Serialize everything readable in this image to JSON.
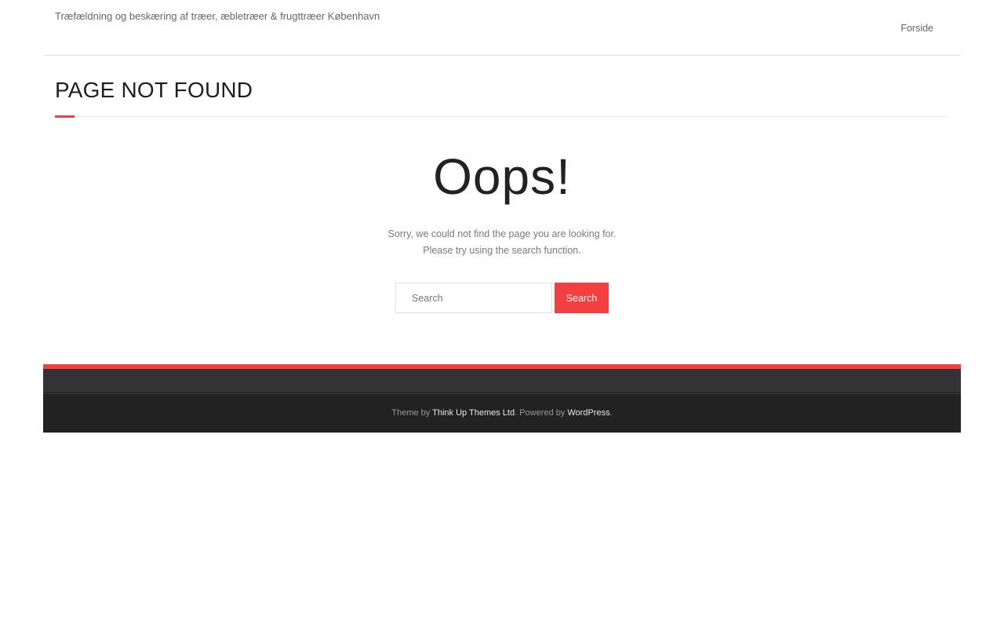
{
  "header": {
    "tagline": "Træfældning og beskæring af træer, æbletræer & frugttræer København",
    "nav": {
      "home_label": "Forside"
    }
  },
  "intro": {
    "title": "PAGE NOT FOUND"
  },
  "content": {
    "heading": "Oops!",
    "message_line1": "Sorry, we could not find the page you are looking for.",
    "message_line2": "Please try using the search function.",
    "search": {
      "placeholder": "Search",
      "button_label": "Search"
    }
  },
  "footer": {
    "theme_prefix": "Theme by",
    "theme_link": "Think Up Themes Ltd",
    "powered_prefix": ". Powered by",
    "powered_link": "WordPress",
    "suffix": "."
  },
  "colors": {
    "accent": "#f33f3f",
    "footer_top": "#333333",
    "footer_bottom": "#222222"
  }
}
